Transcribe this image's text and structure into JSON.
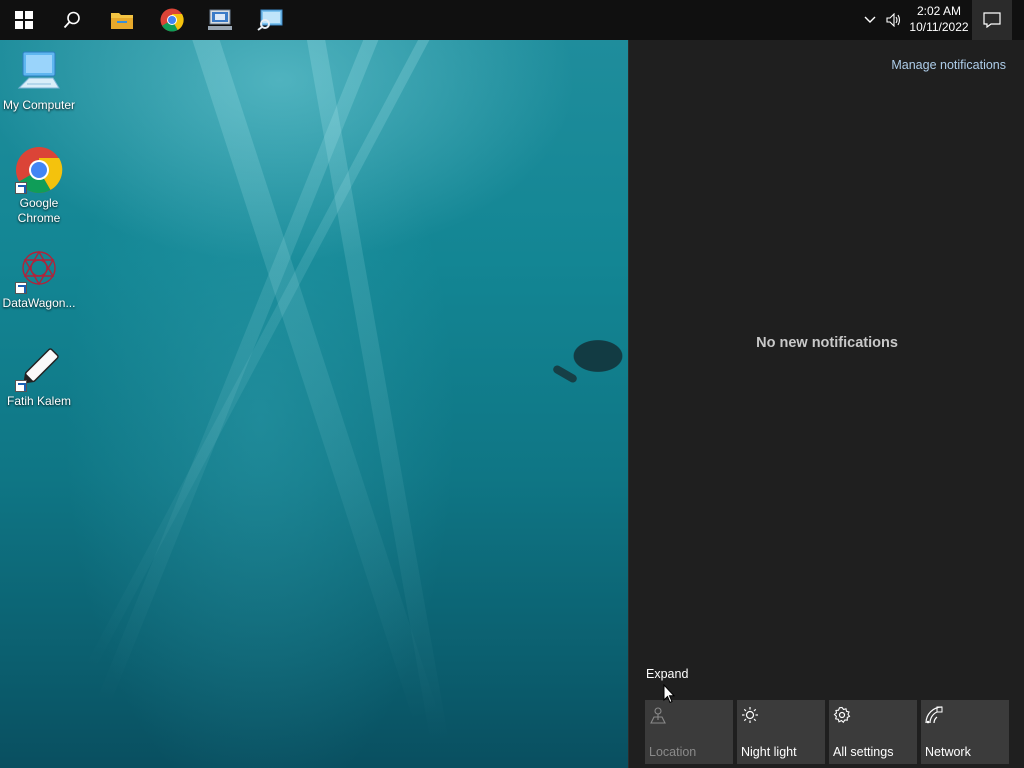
{
  "desktop": {
    "icons": [
      {
        "label": "My Computer",
        "icon": "computer-icon"
      },
      {
        "label": "Google Chrome",
        "icon": "chrome-icon"
      },
      {
        "label": "DataWagon...",
        "icon": "datawagon-icon"
      },
      {
        "label": "Fatih Kalem",
        "icon": "fatih-kalem-icon"
      }
    ]
  },
  "taskbar": {
    "start_icon": "windows-start-icon",
    "search_icon": "search-icon",
    "pinned": [
      "file-explorer-icon",
      "chrome-icon",
      "remote-desktop-icon",
      "network-monitor-icon"
    ],
    "tray": {
      "time": "2:02 AM",
      "date": "10/11/2022",
      "icons": [
        "chevron-up-icon",
        "volume-icon",
        "notification-icon"
      ]
    }
  },
  "action_center": {
    "manage_label": "Manage notifications",
    "empty_message": "No new notifications",
    "expand_label": "Expand",
    "quick_actions": [
      {
        "label": "Location",
        "icon": "location-icon",
        "enabled": false
      },
      {
        "label": "Night light",
        "icon": "night-light-icon",
        "enabled": true
      },
      {
        "label": "All settings",
        "icon": "gear-icon",
        "enabled": true
      },
      {
        "label": "Network",
        "icon": "network-icon",
        "enabled": true
      }
    ]
  },
  "colors": {
    "taskbar": "#101010",
    "action_center_bg": "#1f1f1f",
    "tile_bg": "#3b3b3b",
    "link": "#aecde9"
  }
}
